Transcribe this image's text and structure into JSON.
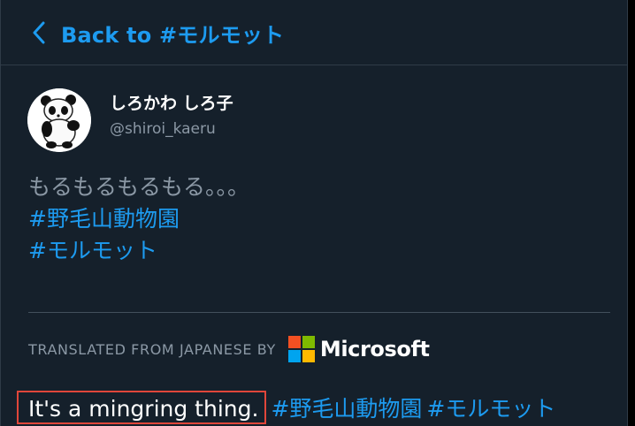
{
  "header": {
    "back_label": "Back to #モルモット"
  },
  "tweet": {
    "author": {
      "display_name": "しろかわ しろ子",
      "username": "@shiroi_kaeru"
    },
    "text": "もるもるもるもる。。。",
    "hashtags": [
      "#野毛山動物園",
      "#モルモット"
    ]
  },
  "translation": {
    "label": "TRANSLATED FROM JAPANESE BY",
    "provider": "Microsoft",
    "text": "It's a mingring thing.",
    "hashtags": [
      "#野毛山動物園",
      "#モルモット"
    ]
  },
  "colors": {
    "background": "#15202b",
    "accent": "#1d9bf0",
    "highlight_border": "#e0463a"
  }
}
